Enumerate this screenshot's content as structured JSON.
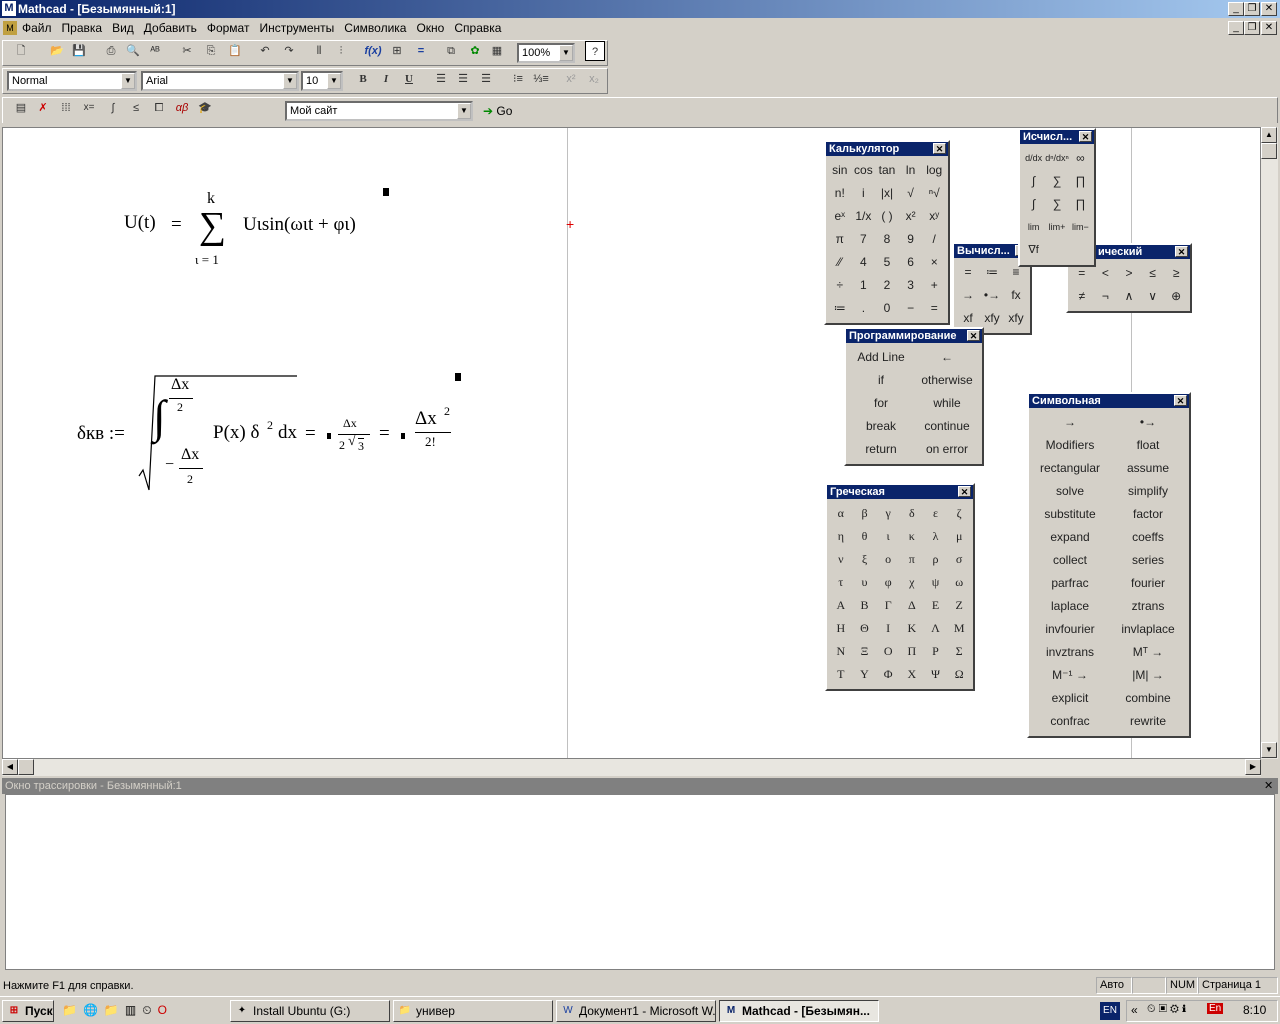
{
  "window": {
    "title": "Mathcad - [Безымянный:1]"
  },
  "menu": [
    "Файл",
    "Правка",
    "Вид",
    "Добавить",
    "Формат",
    "Инструменты",
    "Символика",
    "Окно",
    "Справка"
  ],
  "toolbar": {
    "zoom": "100%",
    "style": "Normal",
    "font": "Arial",
    "size": "10",
    "bold": "B",
    "italic": "I",
    "underline": "U",
    "site": "Мой сайт",
    "go": "Go"
  },
  "equation1": {
    "lhs": "U(t)",
    "eq": "=",
    "upper": "k",
    "lower": "ι = 1",
    "sigma": "∑",
    "body": "Uιsin(ωιt + φι)"
  },
  "equation2": {
    "lhs": "δкв :=",
    "upper_num": "Δx",
    "upper_den": "2",
    "lower_num": "Δx",
    "lower_den": "2",
    "lower_sign": "−",
    "integrand": "P(x) δ",
    "sq": "2",
    "dx": "dx",
    "eq": "=",
    "r1_num": "Δx",
    "r1_den": "2",
    "r1_root": "3",
    "eq2": "=",
    "r2_num": "Δx",
    "r2_sq": "2",
    "r2_den": "2!"
  },
  "palettes": {
    "calculator": {
      "title": "Калькулятор",
      "cells": [
        "sin",
        "cos",
        "tan",
        "ln",
        "log",
        "n!",
        "i",
        "|x|",
        "√",
        "ⁿ√",
        "eˣ",
        "1/x",
        "( )",
        "x²",
        "xʸ",
        "π",
        "7",
        "8",
        "9",
        "/",
        "⁄⁄",
        "4",
        "5",
        "6",
        "×",
        "÷",
        "1",
        "2",
        "3",
        "+",
        "≔",
        ".",
        "0",
        "−",
        "="
      ]
    },
    "calculus": {
      "title": "Исчисл...",
      "cells": [
        "d/dx",
        "dⁿ/dxⁿ",
        "∞",
        "∫",
        "∑",
        "∏",
        "∫",
        "∑",
        "∏",
        "lim",
        "lim+",
        "lim−",
        "∇f"
      ]
    },
    "evaluation": {
      "title": "Вычисл...",
      "cells": [
        "=",
        "≔",
        "≡",
        "→",
        "•→",
        "fx",
        "xf",
        "xfy",
        "xfy"
      ]
    },
    "boolean": {
      "title": "ический",
      "cells": [
        "=",
        "<",
        ">",
        "≤",
        "≥",
        "≠",
        "¬",
        "∧",
        "∨",
        "⊕"
      ]
    },
    "programming": {
      "title": "Программирование",
      "cells": [
        "Add Line",
        "←",
        "if",
        "otherwise",
        "for",
        "while",
        "break",
        "continue",
        "return",
        "on error"
      ]
    },
    "greek": {
      "title": "Греческая",
      "cells": [
        "α",
        "β",
        "γ",
        "δ",
        "ε",
        "ζ",
        "η",
        "θ",
        "ι",
        "κ",
        "λ",
        "μ",
        "ν",
        "ξ",
        "ο",
        "π",
        "ρ",
        "σ",
        "τ",
        "υ",
        "φ",
        "χ",
        "ψ",
        "ω",
        "Α",
        "Β",
        "Γ",
        "Δ",
        "Ε",
        "Ζ",
        "Η",
        "Θ",
        "Ι",
        "Κ",
        "Λ",
        "Μ",
        "Ν",
        "Ξ",
        "Ο",
        "Π",
        "Ρ",
        "Σ",
        "Τ",
        "Υ",
        "Φ",
        "Χ",
        "Ψ",
        "Ω"
      ]
    },
    "symbolic": {
      "title": "Символьная",
      "cells": [
        "→",
        "•→",
        "Modifiers",
        "float",
        "rectangular",
        "assume",
        "solve",
        "simplify",
        "substitute",
        "factor",
        "expand",
        "coeffs",
        "collect",
        "series",
        "parfrac",
        "fourier",
        "laplace",
        "ztrans",
        "invfourier",
        "invlaplace",
        "invztrans",
        "Mᵀ →",
        "M⁻¹ →",
        "|M| →",
        "explicit",
        "combine",
        "confrac",
        "rewrite"
      ]
    }
  },
  "trace": {
    "title": "Окно трассировки - Безымянный:1"
  },
  "status": {
    "help": "Нажмите F1 для справки.",
    "mode": "Авто",
    "num": "NUM",
    "page": "Страница 1"
  },
  "taskbar": {
    "start": "Пуск",
    "tasks": [
      "Install Ubuntu (G:)",
      "универ",
      "Документ1 - Microsoft W...",
      "Mathcad - [Безымян..."
    ],
    "lang": "EN",
    "lang2": "En",
    "clock": "8:10"
  }
}
